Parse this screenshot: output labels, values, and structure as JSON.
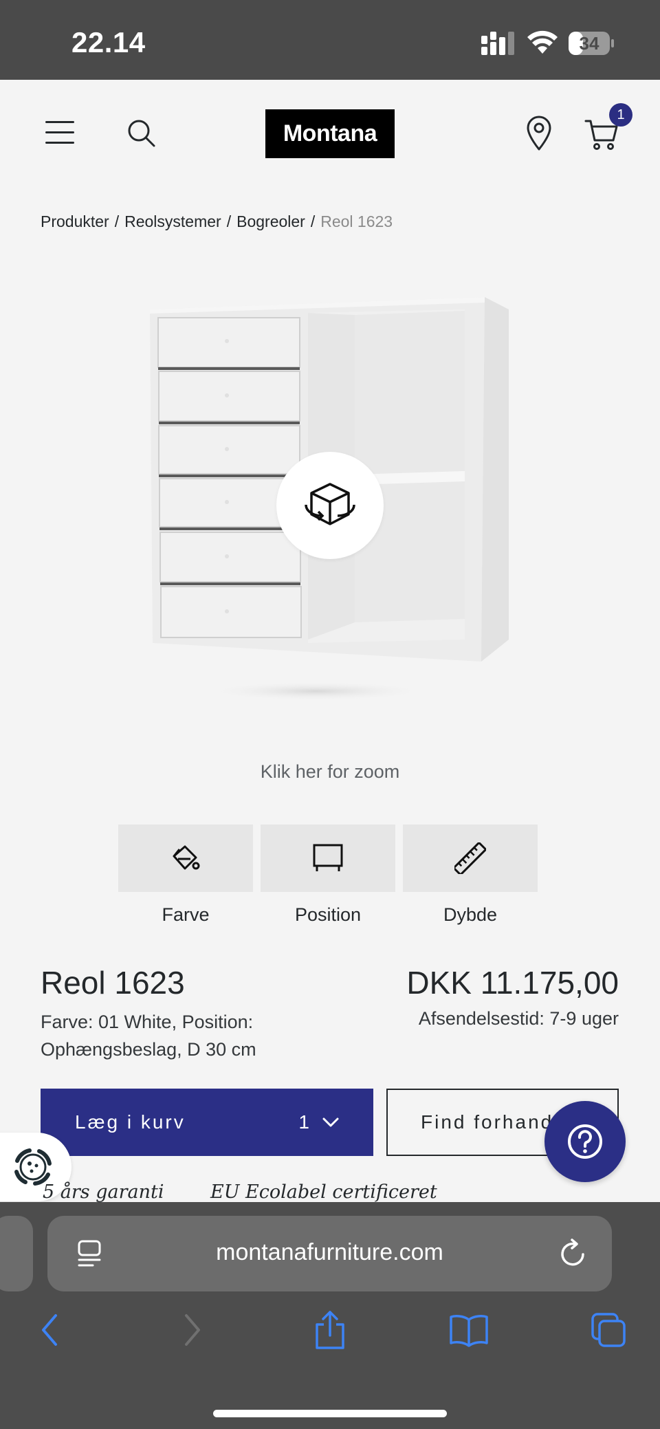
{
  "status_bar": {
    "time": "22.14",
    "battery": "34"
  },
  "header": {
    "logo": "Montana",
    "cart_count": "1"
  },
  "breadcrumb": {
    "items": [
      "Produkter",
      "Reolsystemer",
      "Bogreoler"
    ],
    "separator": "/",
    "current": "Reol 1623"
  },
  "gallery": {
    "zoom_hint": "Klik her for zoom"
  },
  "options": [
    {
      "label": "Farve",
      "icon": "paint-bucket-icon"
    },
    {
      "label": "Position",
      "icon": "frame-icon"
    },
    {
      "label": "Dybde",
      "icon": "ruler-icon"
    }
  ],
  "product": {
    "title": "Reol 1623",
    "description": "Farve: 01 White, Position: Ophængsbeslag, D 30 cm",
    "price": "DKK 11.175,00",
    "shipping": "Afsendelsestid: 7-9 uger"
  },
  "actions": {
    "add_to_cart": "Læg i kurv",
    "quantity": "1",
    "find_dealer": "Find forhandler"
  },
  "perks": [
    "5 års garanti",
    "EU Ecolabel certificeret"
  ],
  "browser": {
    "url": "montanafurniture.com"
  },
  "colors": {
    "brand_blue": "#2b2f86",
    "status_bar": "#4a4a4a",
    "safari_bar": "#4d4d4d",
    "ios_blue": "#3d83f5"
  }
}
